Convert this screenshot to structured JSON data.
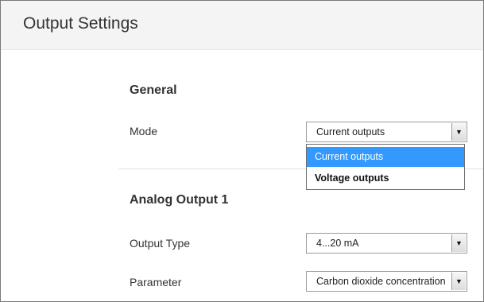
{
  "header": {
    "title": "Output Settings"
  },
  "general": {
    "title": "General",
    "mode": {
      "label": "Mode",
      "selected": "Current outputs",
      "options": [
        "Current outputs",
        "Voltage outputs"
      ],
      "highlighted_option": "Current outputs"
    }
  },
  "analog_output_1": {
    "title": "Analog Output 1",
    "output_type": {
      "label": "Output Type",
      "selected": "4...20 mA"
    },
    "parameter": {
      "label": "Parameter",
      "selected": "Carbon dioxide concentration"
    }
  },
  "icons": {
    "dropdown_arrow": "▼"
  },
  "colors": {
    "highlight": "#3399ff",
    "header_bg": "#f4f4f4"
  }
}
